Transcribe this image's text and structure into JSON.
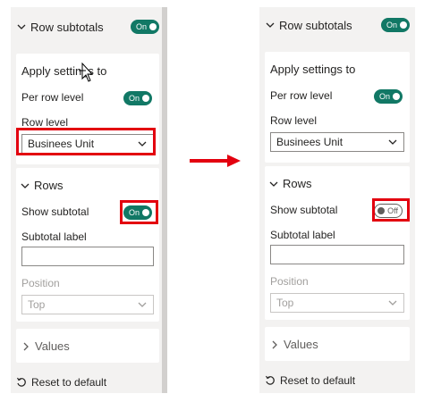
{
  "colors": {
    "toggle_on": "#117865",
    "highlight": "#e3000f",
    "arrow": "#e3000f",
    "panel_bg": "#f3f2f1"
  },
  "panels": [
    {
      "header": {
        "title": "Row subtotals",
        "toggle": "On"
      },
      "apply": {
        "title": "Apply settings to",
        "per_row_label": "Per row level",
        "per_row_toggle": "On",
        "row_level_label": "Row level",
        "row_level_value": "Businees Unit"
      },
      "rows": {
        "title": "Rows",
        "show_subtotal_label": "Show subtotal",
        "show_subtotal_toggle": "On",
        "subtotal_label_label": "Subtotal label",
        "subtotal_label_value": "",
        "position_label": "Position",
        "position_value": "Top"
      },
      "values": {
        "title": "Values"
      },
      "reset_label": "Reset to default"
    },
    {
      "header": {
        "title": "Row subtotals",
        "toggle": "On"
      },
      "apply": {
        "title": "Apply settings to",
        "per_row_label": "Per row level",
        "per_row_toggle": "On",
        "row_level_label": "Row level",
        "row_level_value": "Businees Unit"
      },
      "rows": {
        "title": "Rows",
        "show_subtotal_label": "Show subtotal",
        "show_subtotal_toggle": "Off",
        "subtotal_label_label": "Subtotal label",
        "subtotal_label_value": "",
        "position_label": "Position",
        "position_value": "Top"
      },
      "values": {
        "title": "Values"
      },
      "reset_label": "Reset to default"
    }
  ]
}
